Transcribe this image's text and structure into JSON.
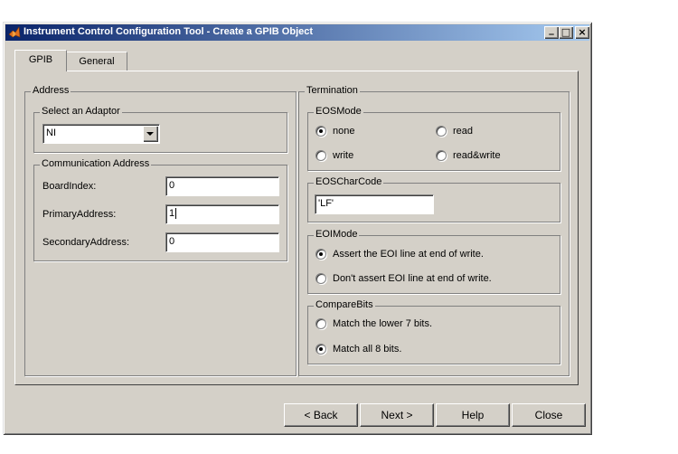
{
  "window": {
    "title": "Instrument Control Configuration Tool - Create a GPIB Object"
  },
  "tabs": [
    {
      "label": "GPIB"
    },
    {
      "label": "General"
    }
  ],
  "address": {
    "title": "Address",
    "adaptor": {
      "title": "Select an Adaptor",
      "value": "NI"
    },
    "comm": {
      "title": "Communication Address",
      "board_index": {
        "label": "BoardIndex:",
        "value": "0"
      },
      "primary_address": {
        "label": "PrimaryAddress:",
        "value": "1"
      },
      "secondary_address": {
        "label": "SecondaryAddress:",
        "value": "0"
      }
    }
  },
  "termination": {
    "title": "Termination",
    "eosmode": {
      "title": "EOSMode",
      "options": [
        "none",
        "read",
        "write",
        "read&write"
      ],
      "selected": "none"
    },
    "eoscharcode": {
      "title": "EOSCharCode",
      "value": "'LF'"
    },
    "eoimode": {
      "title": "EOIMode",
      "options": [
        "Assert the EOI line at end of write.",
        "Don't assert EOI line at end of write."
      ],
      "selected": "Assert the EOI line at end of write."
    },
    "comparebits": {
      "title": "CompareBits",
      "options": [
        "Match the lower 7 bits.",
        "Match all 8 bits."
      ],
      "selected": "Match all 8 bits."
    }
  },
  "buttons": {
    "back": "< Back",
    "next": "Next >",
    "help": "Help",
    "close": "Close"
  },
  "titlebar_buttons": {
    "minimize": "_",
    "maximize": "□",
    "close": "×"
  },
  "colors": {
    "face": "#d4d0c8",
    "title_start": "#0a246a",
    "title_end": "#a6caf0"
  }
}
